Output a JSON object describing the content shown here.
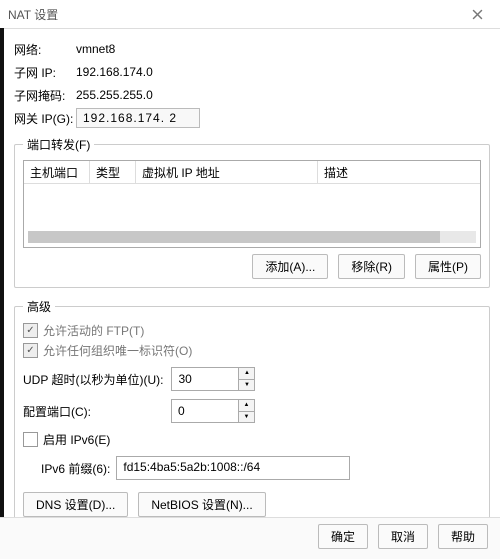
{
  "title": "NAT 设置",
  "info": {
    "network_label": "网络:",
    "network_value": "vmnet8",
    "subnet_ip_label": "子网 IP:",
    "subnet_ip_value": "192.168.174.0",
    "subnet_mask_label": "子网掩码:",
    "subnet_mask_value": "255.255.255.0",
    "gateway_label": "网关 IP(G):",
    "gateway_value": "192.168.174. 2"
  },
  "port_forward": {
    "legend": "端口转发(F)",
    "columns": {
      "host_port": "主机端口",
      "type": "类型",
      "vm_ip": "虚拟机 IP 地址",
      "description": "描述"
    },
    "buttons": {
      "add": "添加(A)...",
      "remove": "移除(R)",
      "properties": "属性(P)"
    }
  },
  "advanced": {
    "legend": "高级",
    "allow_ftp": "允许活动的 FTP(T)",
    "allow_oui": "允许任何组织唯一标识符(O)",
    "udp_timeout_label": "UDP 超时(以秒为单位)(U):",
    "udp_timeout_value": "30",
    "config_port_label": "配置端口(C):",
    "config_port_value": "0",
    "enable_ipv6": "启用 IPv6(E)",
    "ipv6_prefix_label": "IPv6 前缀(6):",
    "ipv6_prefix_value": "fd15:4ba5:5a2b:1008::/64",
    "dns_btn": "DNS 设置(D)...",
    "netbios_btn": "NetBIOS 设置(N)..."
  },
  "footer": {
    "ok": "确定",
    "cancel": "取消",
    "help": "帮助"
  }
}
